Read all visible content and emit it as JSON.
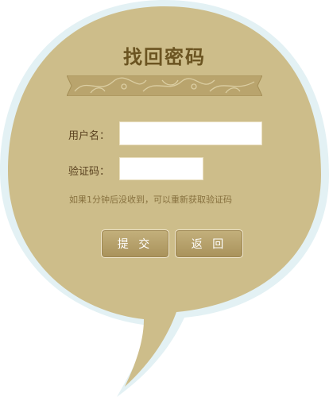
{
  "title": "找回密码",
  "form": {
    "username_label": "用户名：",
    "username_value": "",
    "captcha_label": "验证码：",
    "captcha_value": "",
    "hint": "如果1分钟后没收到，可以重新获取验证码"
  },
  "buttons": {
    "submit": "提 交",
    "back": "返 回"
  },
  "colors": {
    "bubble_fill": "#cdbd8a",
    "bubble_rim": "#e3f1f4",
    "title": "#6b5421",
    "button": "#b49e66"
  }
}
